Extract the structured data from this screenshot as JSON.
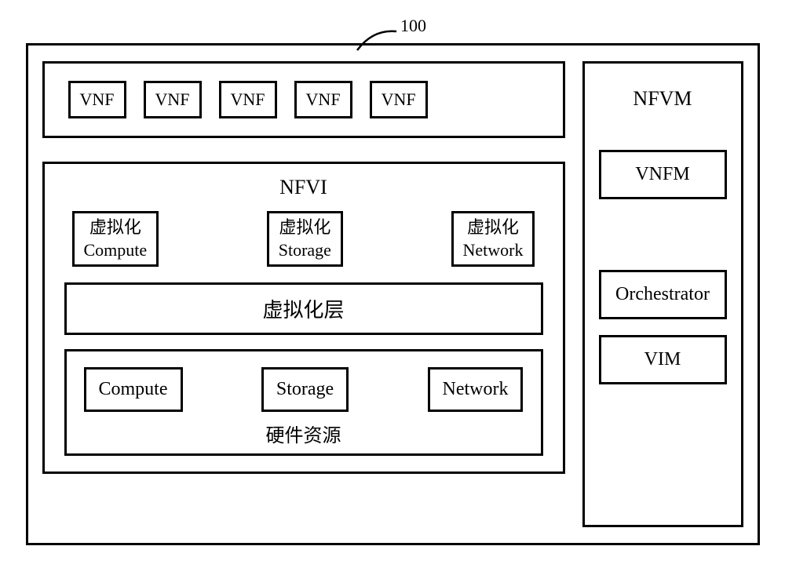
{
  "annotation": "100",
  "left": {
    "vnf_row": {
      "items": [
        "VNF",
        "VNF",
        "VNF",
        "VNF",
        "VNF"
      ]
    },
    "nfvi": {
      "title": "NFVI",
      "virtual": {
        "compute": {
          "zh": "虚拟化",
          "en": "Compute"
        },
        "storage": {
          "zh": "虚拟化",
          "en": "Storage"
        },
        "network": {
          "zh": "虚拟化",
          "en": "Network"
        }
      },
      "virt_layer": "虚拟化层",
      "hardware": {
        "compute": "Compute",
        "storage": "Storage",
        "network": "Network",
        "label": "硬件资源"
      }
    }
  },
  "right": {
    "title": "NFVM",
    "vnfm": "VNFM",
    "orchestrator": "Orchestrator",
    "vim": "VIM"
  }
}
